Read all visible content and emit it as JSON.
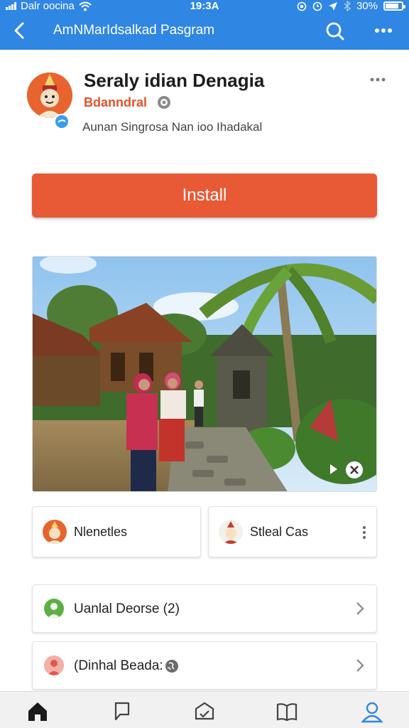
{
  "status_bar": {
    "carrier": "Dalr oocina",
    "time": "19:3A",
    "battery": "30%"
  },
  "nav": {
    "title": "AmNMarIdsalkad Pasgram",
    "icons": [
      "back-arrow-icon",
      "search-icon",
      "more-horizontal-icon"
    ]
  },
  "profile": {
    "name": "Seraly idian Denagia",
    "handle": "Bdanndral",
    "subtitle": "Aunan Singrosa Nan ioo Ihadakal"
  },
  "install_button": {
    "label": "Install"
  },
  "photo": {
    "icons": [
      "play-icon",
      "close-circle-icon"
    ]
  },
  "cards": [
    {
      "label": "Nlenetles"
    },
    {
      "label": "Stleal Cas"
    }
  ],
  "rows": [
    {
      "label": "Uanlal Deorse (2)"
    },
    {
      "label": "(Dinhal Beada:"
    }
  ],
  "tabbar": {
    "tabs": [
      "home-icon",
      "chat-icon",
      "package-icon",
      "book-icon",
      "profile-icon"
    ],
    "active_color": "#2f86e3"
  },
  "colors": {
    "header": "#2f86e3",
    "accent": "#e85a35"
  }
}
